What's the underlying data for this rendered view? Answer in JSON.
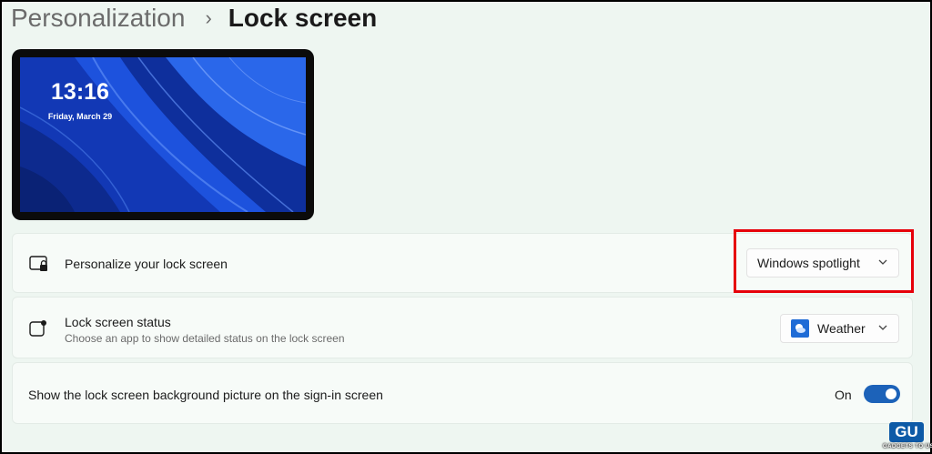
{
  "breadcrumb": {
    "parent": "Personalization",
    "separator": "›",
    "current": "Lock screen"
  },
  "preview": {
    "time": "13:16",
    "date": "Friday, March 29"
  },
  "personalize": {
    "title": "Personalize your lock screen",
    "value": "Windows spotlight"
  },
  "status": {
    "title": "Lock screen status",
    "description": "Choose an app to show detailed status on the lock screen",
    "value": "Weather"
  },
  "signin": {
    "title": "Show the lock screen background picture on the sign-in screen",
    "state_label": "On",
    "enabled": true
  },
  "watermark": {
    "text": "GADGETS TO USE"
  },
  "colors": {
    "accent": "#1c62b9",
    "highlight": "#e6000a",
    "wallpaper": "#1742c7"
  },
  "icons": {
    "row1": "lock-screen-monitor-icon",
    "row2": "status-app-icon",
    "weather": "weather-icon",
    "chevron": "chevron-down-icon"
  }
}
